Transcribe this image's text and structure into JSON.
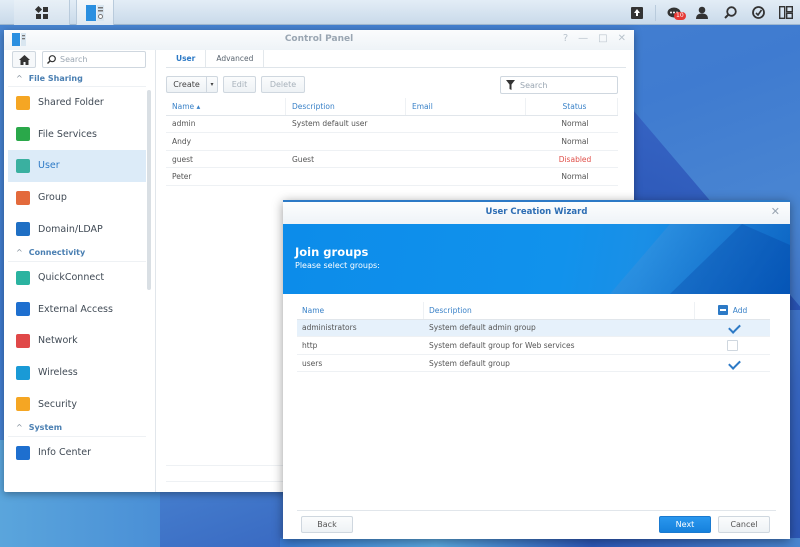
{
  "taskbar": {
    "left_icons": [
      "main-menu-icon",
      "control-panel-icon"
    ],
    "right_icons": [
      "upload-icon",
      "notifications-icon",
      "user-icon",
      "search-icon",
      "dashboard-icon",
      "widgets-icon"
    ],
    "notification_count": "10"
  },
  "control_panel": {
    "title": "Control Panel",
    "search_placeholder": "Search",
    "sidebar": {
      "sections": [
        {
          "title": "File Sharing",
          "items": [
            {
              "label": "Shared Folder",
              "icon": "shared-folder-icon",
              "color": "#f5a623"
            },
            {
              "label": "File Services",
              "icon": "file-services-icon",
              "color": "#2aa84a"
            },
            {
              "label": "User",
              "icon": "user-icon",
              "color": "#3ab0a0",
              "active": true
            },
            {
              "label": "Group",
              "icon": "group-icon",
              "color": "#e36a3c"
            },
            {
              "label": "Domain/LDAP",
              "icon": "domain-ldap-icon",
              "color": "#1f6fc4"
            }
          ]
        },
        {
          "title": "Connectivity",
          "items": [
            {
              "label": "QuickConnect",
              "icon": "quickconnect-icon",
              "color": "#2bb3a0"
            },
            {
              "label": "External Access",
              "icon": "external-access-icon",
              "color": "#1e6fcf"
            },
            {
              "label": "Network",
              "icon": "network-icon",
              "color": "#e04848"
            },
            {
              "label": "Wireless",
              "icon": "wireless-icon",
              "color": "#1a9ad6"
            },
            {
              "label": "Security",
              "icon": "security-icon",
              "color": "#f5a623"
            }
          ]
        },
        {
          "title": "System",
          "items": [
            {
              "label": "Info Center",
              "icon": "info-center-icon",
              "color": "#1e6fcf"
            }
          ]
        }
      ]
    },
    "tabs": [
      {
        "label": "User",
        "active": true
      },
      {
        "label": "Advanced",
        "active": false
      }
    ],
    "toolbar": {
      "create": "Create",
      "edit": "Edit",
      "delete": "Delete",
      "filter_placeholder": "Search"
    },
    "grid": {
      "columns": [
        "Name ▴",
        "Description",
        "Email",
        "Status"
      ],
      "rows": [
        {
          "name": "admin",
          "description": "System default user",
          "email": "",
          "status": "Normal"
        },
        {
          "name": "Andy",
          "description": "",
          "email": "",
          "status": "Normal"
        },
        {
          "name": "guest",
          "description": "Guest",
          "email": "",
          "status": "Disabled"
        },
        {
          "name": "Peter",
          "description": "",
          "email": "",
          "status": "Normal"
        }
      ]
    }
  },
  "wizard": {
    "title": "User Creation Wizard",
    "heading": "Join groups",
    "subheading": "Please select groups:",
    "columns": [
      "Name",
      "Description",
      "Add"
    ],
    "rows": [
      {
        "name": "administrators",
        "description": "System default admin group",
        "checked": true,
        "selected": true
      },
      {
        "name": "http",
        "description": "System default group for Web services",
        "checked": false,
        "selected": false
      },
      {
        "name": "users",
        "description": "System default group",
        "checked": true,
        "selected": false
      }
    ],
    "buttons": {
      "back": "Back",
      "next": "Next",
      "cancel": "Cancel"
    }
  }
}
